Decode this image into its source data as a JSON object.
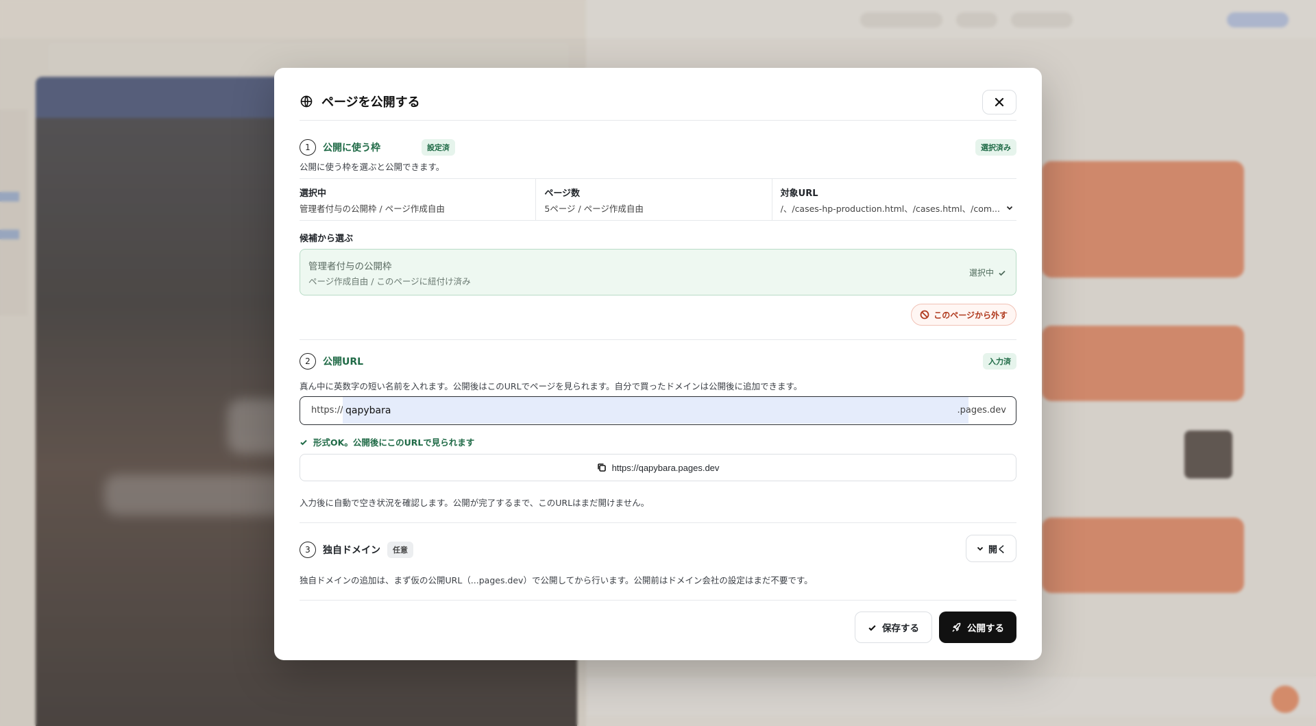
{
  "modal": {
    "title": "ページを公開する",
    "close_icon": "close-icon"
  },
  "step1": {
    "num": "1",
    "title": "公開に使う枠",
    "status_badge": "設定済",
    "right_badge": "選択済み",
    "description": "公開に使う枠を選ぶと公開できます。",
    "info": [
      {
        "label": "選択中",
        "value": "管理者付与の公開枠 / ページ作成自由"
      },
      {
        "label": "ページ数",
        "value": "5ページ / ページ作成自由"
      },
      {
        "label": "対象URL",
        "value": "/、/cases-hp-production.html、/cases.html、/com..."
      }
    ],
    "candidates_heading": "候補から選ぶ",
    "candidate": {
      "title": "管理者付与の公開枠",
      "subtitle": "ページ作成自由 / このページに紐付け済み",
      "state": "選択中"
    },
    "detach_label": "このページから外す"
  },
  "step2": {
    "num": "2",
    "title": "公開URL",
    "right_badge": "入力済",
    "description": "真ん中に英数字の短い名前を入れます。公開後はこのURLでページを見られます。自分で買ったドメインは公開後に追加できます。",
    "prefix": "https://",
    "value": "qapybara",
    "suffix": ".pages.dev",
    "ok_message": "形式OK。公開後にこのURLで見られます",
    "full_url": "https://qapybara.pages.dev",
    "note": "入力後に自動で空き状況を確認します。公開が完了するまで、このURLはまだ開けません。"
  },
  "step3": {
    "num": "3",
    "title": "独自ドメイン",
    "optional_badge": "任意",
    "open_label": "開く",
    "description": "独自ドメインの追加は、まず仮の公開URL（...pages.dev）で公開してから行います。公開前はドメイン会社の設定はまだ不要です。"
  },
  "footer": {
    "save_label": "保存する",
    "publish_label": "公開する"
  },
  "colors": {
    "accent_green": "#1f6a46",
    "danger": "#b03a1e",
    "primary_button": "#111111"
  }
}
